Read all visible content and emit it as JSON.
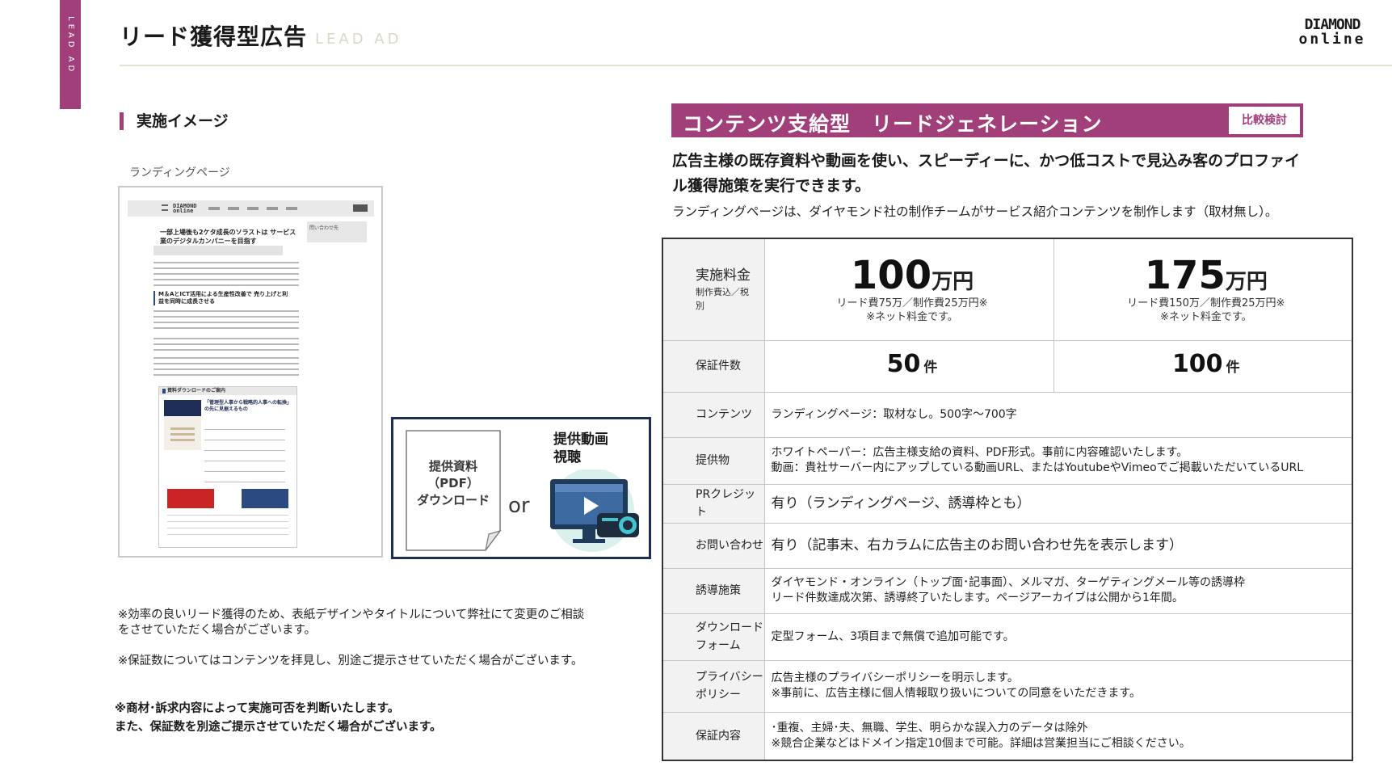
{
  "header": {
    "side_tab": "LEAD AD",
    "title": "リード獲得型広告",
    "subtitle": "LEAD AD",
    "logo_line1": "DIAMOND",
    "logo_line2": "online"
  },
  "left": {
    "section_title": "実施イメージ",
    "lp_caption": "ランディングページ",
    "lp_mock": {
      "headline": "一部上場後も2ケタ成長のソラストは サービス業のデジタルカンパニーを目指す",
      "side_box": "問い合わせ先",
      "subhead": "M＆AとICT活用による生産性改善で 売り上げと利益を同時に成長させる",
      "download_head": "資料ダウンロードのご案内",
      "download_title": "「管理型人事から戦略的人事への転換」の先に見据えるもの"
    },
    "offer": {
      "doc_label": "提供資料\n（PDF）\nダウンロード",
      "or": "or",
      "video_label": "提供動画\n視聴"
    },
    "notes": [
      "※効率の良いリード獲得のため、表紙デザインやタイトルについて弊社にて変更のご相談\nをさせていただく場合がございます。",
      "※保証数についてはコンテンツを拝見し、別途ご提示させていただく場合がございます。"
    ],
    "bold_note": "※商材･訴求内容によって実施可否を判断いたします。\nまた、保証数を別途ご提示させていただく場合がございます。"
  },
  "right": {
    "plan_title": "コンテンツ支給型　リードジェネレーション",
    "compare_button": "比較検討",
    "lead_text": "広告主様の既存資料や動画を使い、スピーディーに、かつ低コストで見込み客のプロファイル獲得施策を実行できます。",
    "lead_sub": "ランディングページは、ダイヤモンド社の制作チームがサービス紹介コンテンツを制作します（取材無し）。",
    "table": {
      "price_label": "実施料金",
      "price_label_sub": "制作費込／税別",
      "plans": [
        {
          "price": "100",
          "unit": "万円",
          "detail": "リード費75万／制作費25万円※",
          "net": "※ネット料金です。",
          "count": "50",
          "count_unit": "件"
        },
        {
          "price": "175",
          "unit": "万円",
          "detail": "リード費150万／制作費25万円※",
          "net": "※ネット料金です。",
          "count": "100",
          "count_unit": "件"
        }
      ],
      "count_label": "保証件数",
      "rows": [
        {
          "label": "コンテンツ",
          "value": "ランディングページ：取材なし。500字～700字"
        },
        {
          "label": "提供物",
          "value": "ホワイトペーパー：広告主様支給の資料、PDF形式。事前に内容確認いたします。\n動画：貴社サーバー内にアップしている動画URL、またはYoutubeやVimeoでご掲載いただいているURL"
        },
        {
          "label": "PRクレジット",
          "value": "有り（ランディングページ、誘導枠とも）"
        },
        {
          "label": "お問い合わせ",
          "value": "有り（記事末、右カラムに広告主のお問い合わせ先を表示します）"
        },
        {
          "label": "誘導施策",
          "value": "ダイヤモンド・オンライン（トップ面･記事面）、メルマガ、ターゲティングメール等の誘導枠\nリード件数達成次第、誘導終了いたします。ページアーカイブは公開から1年間。"
        },
        {
          "label": "ダウンロードフォーム",
          "value": "定型フォーム、3項目まで無償で追加可能です。"
        },
        {
          "label": "プライバシーポリシー",
          "value": "広告主様のプライバシーポリシーを明示します。\n※事前に、広告主様に個人情報取り扱いについての同意をいただきます。"
        },
        {
          "label": "保証内容",
          "value": "･重複、主婦･夫、無職、学生、明らかな誤入力のデータは除外\n※競合企業などはドメイン指定10個まで可能。詳細は営業担当にご相談ください。"
        }
      ]
    }
  },
  "colors": {
    "accent": "#a03f79",
    "navy": "#1d2d55",
    "rule": "#e4e0d4"
  },
  "icons": [
    "document-icon",
    "video-monitor-icon",
    "projector-icon",
    "play-icon",
    "menu-icon"
  ]
}
